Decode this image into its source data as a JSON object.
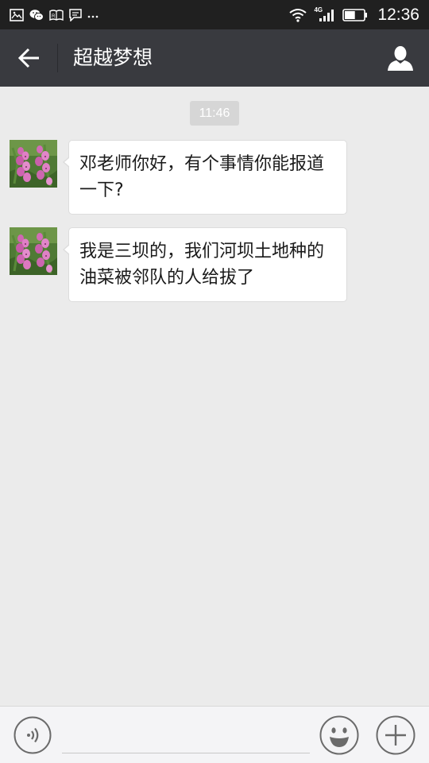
{
  "status_bar": {
    "time": "12:36",
    "network_type": "4G",
    "notification_icons": [
      "image-icon",
      "wechat-icon",
      "reader-icon",
      "message-icon",
      "more-dots-icon"
    ],
    "battery_level": 0.55
  },
  "nav": {
    "title": "超越梦想",
    "back_icon": "arrow-left-icon",
    "profile_icon": "person-icon"
  },
  "chat": {
    "timestamp": "11:46",
    "messages": [
      {
        "sender": "incoming",
        "text": "邓老师你好，有个事情你能报道一下?"
      },
      {
        "sender": "incoming",
        "text": "我是三坝的，我们河坝土地种的油菜被邻队的人给拔了"
      }
    ]
  },
  "input_bar": {
    "placeholder": "",
    "voice_icon": "voice-icon",
    "emoji_icon": "emoji-icon",
    "more_icon": "plus-icon"
  },
  "colors": {
    "status_bar_bg": "#202020",
    "nav_bg": "#393a3f",
    "chat_bg": "#ebebeb",
    "bubble_bg": "#ffffff",
    "timestamp_bg": "#d6d6d6"
  }
}
